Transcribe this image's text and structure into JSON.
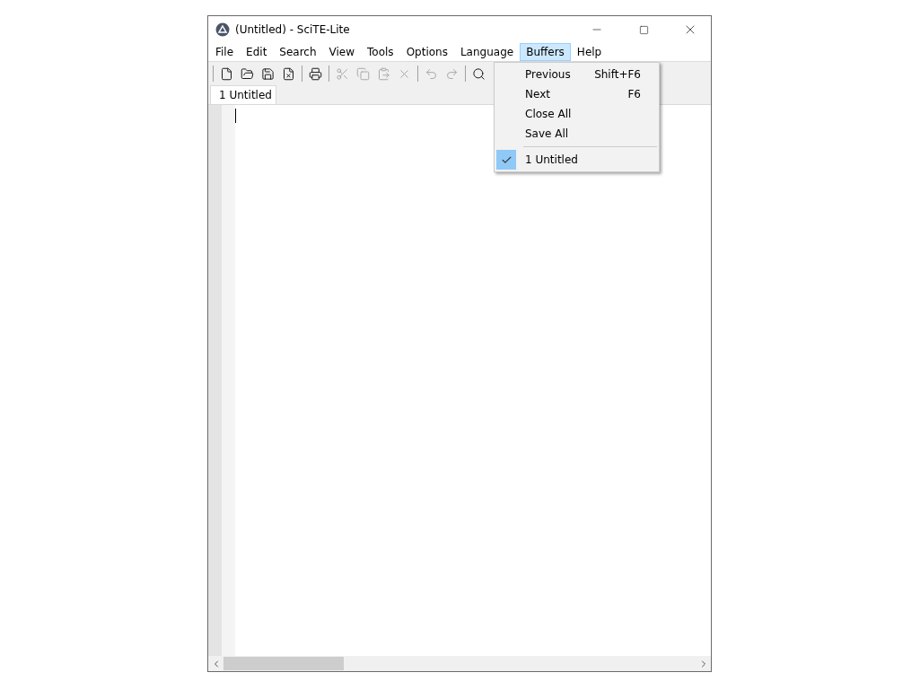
{
  "window": {
    "title": "(Untitled) - SciTE-Lite"
  },
  "menu_bar": [
    {
      "label": "File",
      "selected": false
    },
    {
      "label": "Edit",
      "selected": false
    },
    {
      "label": "Search",
      "selected": false
    },
    {
      "label": "View",
      "selected": false
    },
    {
      "label": "Tools",
      "selected": false
    },
    {
      "label": "Options",
      "selected": false
    },
    {
      "label": "Language",
      "selected": false
    },
    {
      "label": "Buffers",
      "selected": true
    },
    {
      "label": "Help",
      "selected": false
    }
  ],
  "toolbar": [
    [
      {
        "disabled": false
      },
      {
        "disabled": false
      },
      {
        "disabled": false
      },
      {
        "disabled": false
      }
    ],
    [
      {
        "disabled": false
      }
    ],
    [
      {
        "disabled": true
      },
      {
        "disabled": true
      },
      {
        "disabled": true
      },
      {
        "disabled": true
      }
    ],
    [
      {
        "disabled": true
      },
      {
        "disabled": true
      }
    ],
    [
      {
        "disabled": false
      }
    ]
  ],
  "tabs": [
    {
      "label": "1 Untitled",
      "selected": true
    }
  ],
  "dropdown_menu": [
    {
      "kind": "item",
      "label": "Previous",
      "shortcut": "Shift+F6",
      "checked": false
    },
    {
      "kind": "item",
      "label": "Next",
      "shortcut": "F6",
      "checked": false
    },
    {
      "kind": "item",
      "label": "Close All",
      "checked": false
    },
    {
      "kind": "item",
      "label": "Save All",
      "checked": false
    },
    {
      "kind": "separator"
    },
    {
      "kind": "item",
      "label": "1 Untitled",
      "checked": true
    }
  ]
}
